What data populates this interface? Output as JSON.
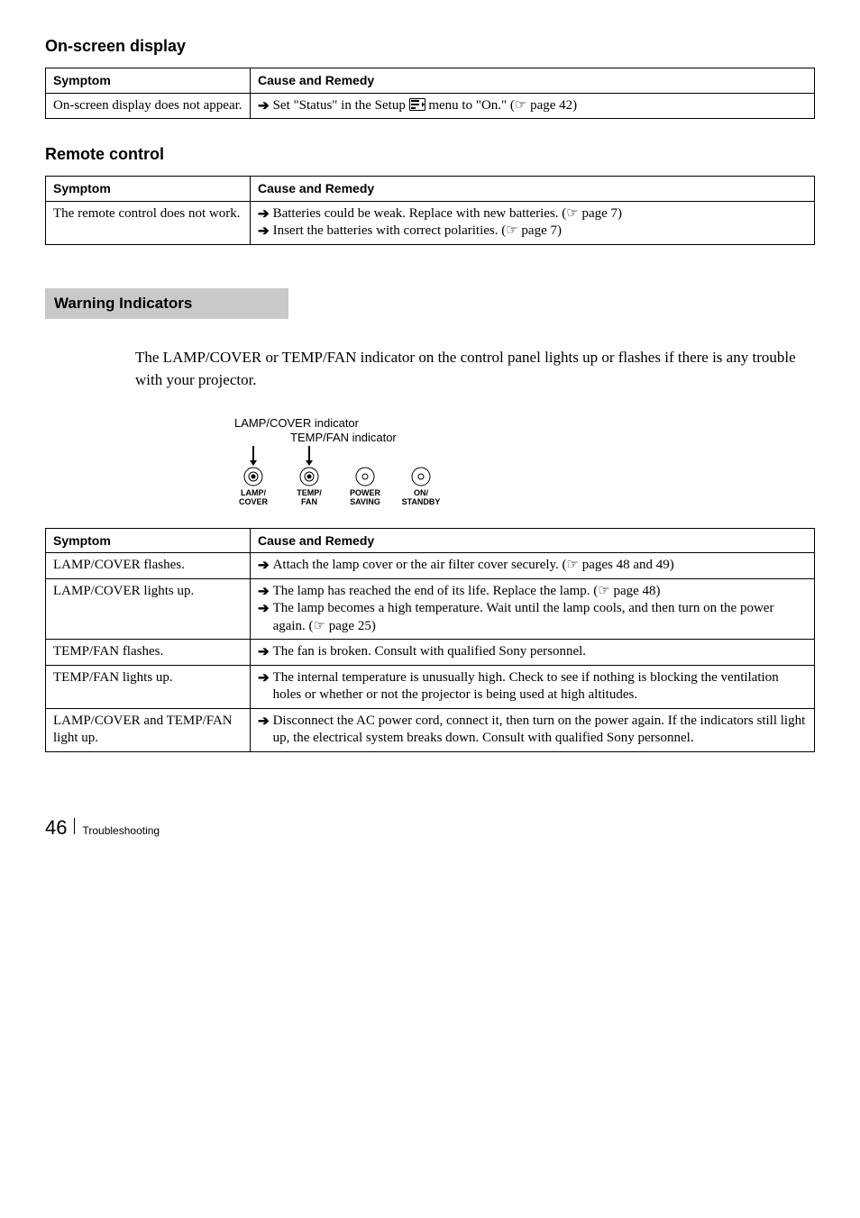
{
  "sections": {
    "onscreen": {
      "title": "On-screen display",
      "col_symptom": "Symptom",
      "col_remedy": "Cause and Remedy",
      "row0_symptom": "On-screen display does not appear.",
      "row0_remedy_pre": "Set \"Status\" in the Setup",
      "row0_remedy_post": "menu to \"On.\" (☞ page 42)"
    },
    "remote": {
      "title": "Remote control",
      "col_symptom": "Symptom",
      "col_remedy": "Cause and Remedy",
      "row0_symptom": "The remote control does not work.",
      "row0_remedy_a": "Batteries could be weak. Replace with new batteries. (☞ page 7)",
      "row0_remedy_b": "Insert the batteries with correct polarities. (☞ page 7)"
    },
    "warning": {
      "heading": "Warning Indicators",
      "paragraph": "The LAMP/COVER or TEMP/FAN indicator on the control panel lights up or flashes if there is any trouble with your projector.",
      "diagram": {
        "lamp_cover_label": "LAMP/COVER indicator",
        "temp_fan_label": "TEMP/FAN indicator",
        "caps": {
          "c0a": "LAMP/",
          "c0b": "COVER",
          "c1a": "TEMP/",
          "c1b": "FAN",
          "c2a": "POWER",
          "c2b": "SAVING",
          "c3a": "ON/",
          "c3b": "STANDBY"
        }
      },
      "table": {
        "col_symptom": "Symptom",
        "col_remedy": "Cause and Remedy",
        "r0_s": "LAMP/COVER flashes.",
        "r0_a": "Attach the lamp cover or the air filter cover securely. (☞ pages 48 and 49)",
        "r1_s": "LAMP/COVER lights up.",
        "r1_a": "The lamp has reached the end of its life. Replace the lamp. (☞ page 48)",
        "r1_b": "The lamp becomes a high temperature. Wait until the lamp cools, and then turn on the power again. (☞ page 25)",
        "r2_s": "TEMP/FAN flashes.",
        "r2_a": "The fan is broken. Consult with qualified Sony personnel.",
        "r3_s": "TEMP/FAN lights up.",
        "r3_a": "The internal temperature is unusually high. Check to see if nothing is blocking the ventilation holes or whether or not the projector is being used at high altitudes.",
        "r4_s": "LAMP/COVER and TEMP/FAN light up.",
        "r4_a": "Disconnect the AC power cord, connect it, then turn on the power again. If the indicators still light up, the electrical system breaks down. Consult with qualified Sony personnel."
      }
    }
  },
  "footer": {
    "page_number": "46",
    "section_name": "Troubleshooting"
  }
}
